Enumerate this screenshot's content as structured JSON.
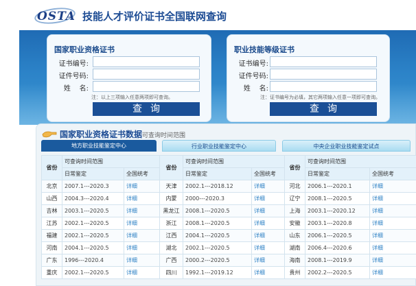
{
  "header": {
    "logo_text": "OSTA",
    "title": "技能人才评价证书全国联网查询"
  },
  "left_panel": {
    "title": "国家职业资格证书",
    "fields": [
      {
        "label": "证书编号:",
        "value": ""
      },
      {
        "label": "证件号码:",
        "value": ""
      },
      {
        "label": "姓    名:",
        "value": ""
      }
    ],
    "note": "注：以上三项输入任意两项即可查询。",
    "button": "查询"
  },
  "right_panel": {
    "title": "职业技能等级证书",
    "fields": [
      {
        "label": "证书编号:",
        "value": ""
      },
      {
        "label": "证件号码:",
        "value": ""
      },
      {
        "label": "姓    名:",
        "value": ""
      }
    ],
    "note": "注：证书编号为必填，其它两项输入任意一项即可查询。",
    "button": "查询"
  },
  "data_section": {
    "title": "国家职业资格证书数据",
    "subtitle": "可查询时间范围",
    "tabs": [
      {
        "label": "地方职业技能鉴定中心",
        "active": true
      },
      {
        "label": "行业职业技能鉴定中心",
        "active": false
      },
      {
        "label": "中央企业职业技能鉴定试点",
        "active": false
      }
    ],
    "table": {
      "col_province": "省份",
      "col_range": "可查询时间范围",
      "col_daily": "日常鉴定",
      "col_exam": "全国统考",
      "link_text": "详细",
      "rows": [
        [
          {
            "p": "北京",
            "d": "2007.1---2020.3"
          },
          {
            "p": "天津",
            "d": "2002.1---2018.12"
          },
          {
            "p": "河北",
            "d": "2006.1---2020.1"
          }
        ],
        [
          {
            "p": "山西",
            "d": "2004.3---2020.4"
          },
          {
            "p": "内蒙",
            "d": "2000---2020.3"
          },
          {
            "p": "辽宁",
            "d": "2008.1---2020.5"
          }
        ],
        [
          {
            "p": "吉林",
            "d": "2003.1---2020.5"
          },
          {
            "p": "黑龙江",
            "d": "2008.1---2020.5"
          },
          {
            "p": "上海",
            "d": "2003.1---2020.12"
          }
        ],
        [
          {
            "p": "江苏",
            "d": "2002.1---2020.5"
          },
          {
            "p": "浙江",
            "d": "2008.1---2020.5"
          },
          {
            "p": "安徽",
            "d": "2003.1---2020.8"
          }
        ],
        [
          {
            "p": "福建",
            "d": "2002.1---2020.5"
          },
          {
            "p": "江西",
            "d": "2004.1---2020.5"
          },
          {
            "p": "山东",
            "d": "2006.1---2020.5"
          }
        ],
        [
          {
            "p": "河南",
            "d": "2004.1---2020.5"
          },
          {
            "p": "湖北",
            "d": "2002.1---2020.5"
          },
          {
            "p": "湖南",
            "d": "2006.4---2020.6"
          }
        ],
        [
          {
            "p": "广东",
            "d": "1996---2020.4"
          },
          {
            "p": "广西",
            "d": "2000.2---2020.5"
          },
          {
            "p": "海南",
            "d": "2008.1---2019.9"
          }
        ],
        [
          {
            "p": "重庆",
            "d": "2002.1---2020.5"
          },
          {
            "p": "四川",
            "d": "1992.1---2019.12"
          },
          {
            "p": "贵州",
            "d": "2002.2---2020.5"
          }
        ]
      ]
    }
  },
  "colors": {
    "brand": "#1d4c94",
    "hero_top": "#1f6bb4",
    "button": "#1a4f96",
    "link": "#2a7fc4"
  }
}
